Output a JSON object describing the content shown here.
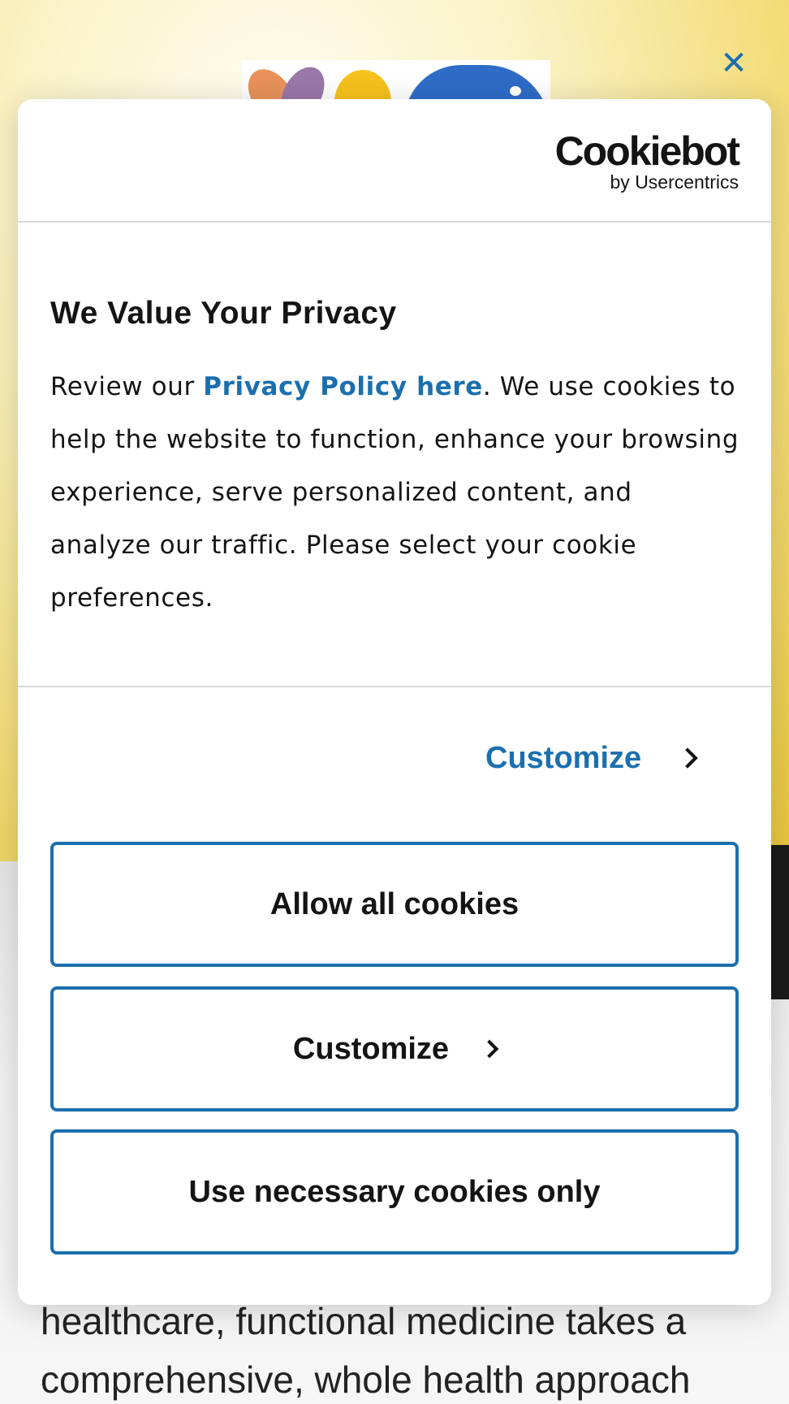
{
  "background": {
    "close_icon": "close-icon",
    "text_lines": [
      "healthcare, functional medicine takes a",
      "comprehensive, whole health approach"
    ]
  },
  "dialog": {
    "brand": {
      "name": "Cookiebot",
      "sub": "by Usercentrics"
    },
    "title": "We Value Your Privacy",
    "text_before_link": "Review our ",
    "policy_link": "Privacy Policy here",
    "text_after_link": ". We use cookies to help the website to function, enhance your browsing experience, serve personalized content, and analyze our traffic. Please select your cookie preferences.",
    "customize_link": "Customize",
    "buttons": {
      "allow_all": "Allow all cookies",
      "customize": "Customize",
      "necessary_only": "Use necessary cookies only"
    }
  },
  "colors": {
    "accent": "#1b6fae",
    "text": "#141414",
    "hero_yellow": "#f3dd7a"
  }
}
